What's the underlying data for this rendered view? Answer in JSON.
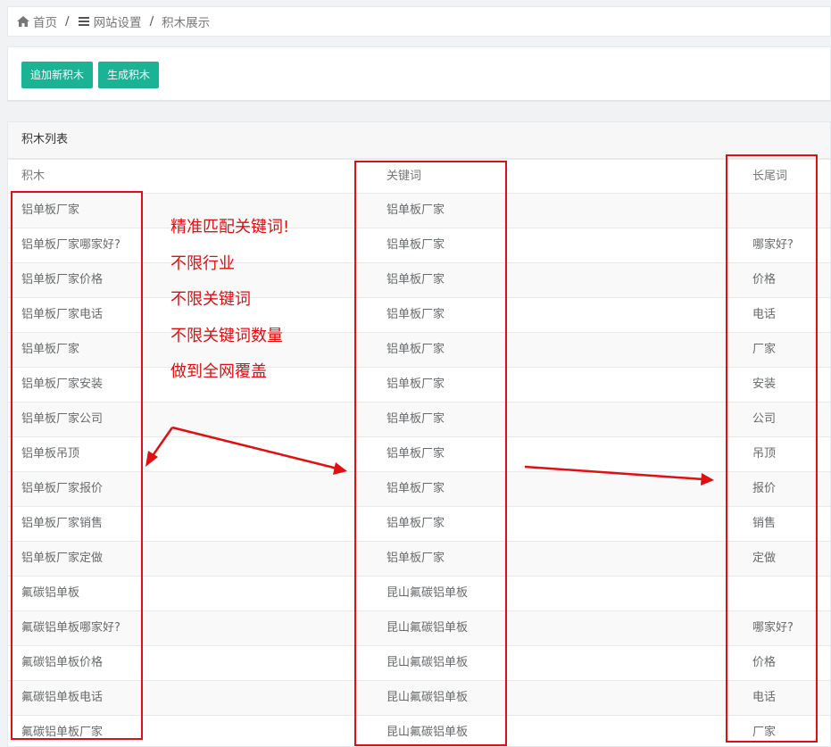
{
  "breadcrumb": {
    "home": "首页",
    "settings": "网站设置",
    "current": "积木展示",
    "separator": "/",
    "icons": [
      "home-icon",
      "menu-icon"
    ]
  },
  "toolbar": {
    "add_label": "追加新积木",
    "generate_label": "生成积木"
  },
  "panel": {
    "title": "积木列表",
    "headers": [
      "积木",
      "关键词",
      "长尾词"
    ],
    "rows": [
      [
        "铝单板厂家",
        "铝单板厂家",
        ""
      ],
      [
        "铝单板厂家哪家好?",
        "铝单板厂家",
        "哪家好?"
      ],
      [
        "铝单板厂家价格",
        "铝单板厂家",
        "价格"
      ],
      [
        "铝单板厂家电话",
        "铝单板厂家",
        "电话"
      ],
      [
        "铝单板厂家",
        "铝单板厂家",
        "厂家"
      ],
      [
        "铝单板厂家安装",
        "铝单板厂家",
        "安装"
      ],
      [
        "铝单板厂家公司",
        "铝单板厂家",
        "公司"
      ],
      [
        "铝单板吊顶",
        "铝单板厂家",
        "吊顶"
      ],
      [
        "铝单板厂家报价",
        "铝单板厂家",
        "报价"
      ],
      [
        "铝单板厂家销售",
        "铝单板厂家",
        "销售"
      ],
      [
        "铝单板厂家定做",
        "铝单板厂家",
        "定做"
      ],
      [
        "氟碳铝单板",
        "昆山氟碳铝单板",
        ""
      ],
      [
        "氟碳铝单板哪家好?",
        "昆山氟碳铝单板",
        "哪家好?"
      ],
      [
        "氟碳铝单板价格",
        "昆山氟碳铝单板",
        "价格"
      ],
      [
        "氟碳铝单板电话",
        "昆山氟碳铝单板",
        "电话"
      ],
      [
        "氟碳铝单板厂家",
        "昆山氟碳铝单板",
        "厂家"
      ]
    ]
  },
  "annotation": {
    "lines": [
      "精准匹配关键词!",
      "不限行业",
      "不限关键词",
      "不限关键词数量",
      "做到全网覆盖"
    ],
    "color": "#e01010"
  },
  "colors": {
    "primary_button": "#1ab394",
    "annotation_red": "#e01010"
  }
}
